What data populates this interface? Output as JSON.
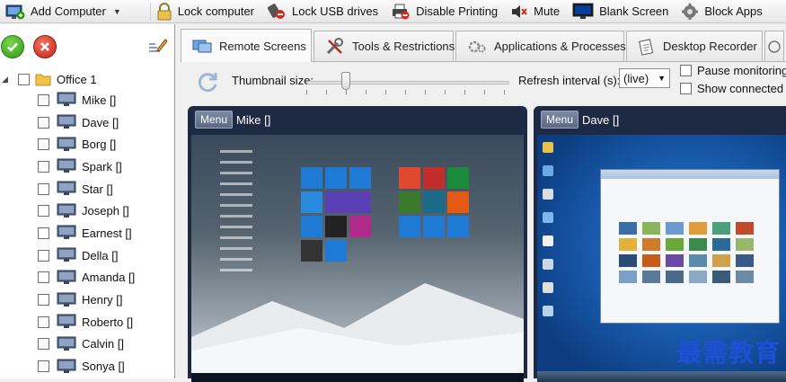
{
  "toolbar": {
    "items": [
      {
        "label": "Add Computer",
        "icon": "add-computer-icon",
        "has_dropdown": true
      },
      {
        "label": "Lock computer",
        "icon": "padlock-icon"
      },
      {
        "label": "Lock USB drives",
        "icon": "usb-lock-icon"
      },
      {
        "label": "Disable Printing",
        "icon": "printer-icon"
      },
      {
        "label": "Mute",
        "icon": "speaker-mute-icon"
      },
      {
        "label": "Blank Screen",
        "icon": "monitor-icon"
      },
      {
        "label": "Block Apps",
        "icon": "block-apps-icon"
      }
    ]
  },
  "tree": {
    "group": "Office 1",
    "computers": [
      "Mike []",
      "Dave []",
      "Borg []",
      "Spark []",
      "Star []",
      "Joseph []",
      "Earnest  []",
      "Della []",
      "Amanda  []",
      "Henry  []",
      "Roberto  []",
      "Calvin  []",
      "Sonya []"
    ]
  },
  "tabs": [
    {
      "label": "Remote Screens",
      "icon": "remote-screens-icon",
      "active": true
    },
    {
      "label": "Tools & Restrictions",
      "icon": "tools-icon"
    },
    {
      "label": "Applications & Processes",
      "icon": "gears-icon"
    },
    {
      "label": "Desktop Recorder",
      "icon": "recorder-icon"
    }
  ],
  "settings": {
    "thumbnail_label": "Thumbnail size:",
    "thumbnail_level": 0.18,
    "refresh_label": "Refresh interval (s):",
    "refresh_value": "(live)",
    "pause_label": "Pause monitoring",
    "show_connected_label": "Show connected o"
  },
  "screens": [
    {
      "menu_label": "Menu",
      "name": "Mike []"
    },
    {
      "menu_label": "Menu",
      "name": "Dave []"
    }
  ],
  "watermark": "最需教育"
}
